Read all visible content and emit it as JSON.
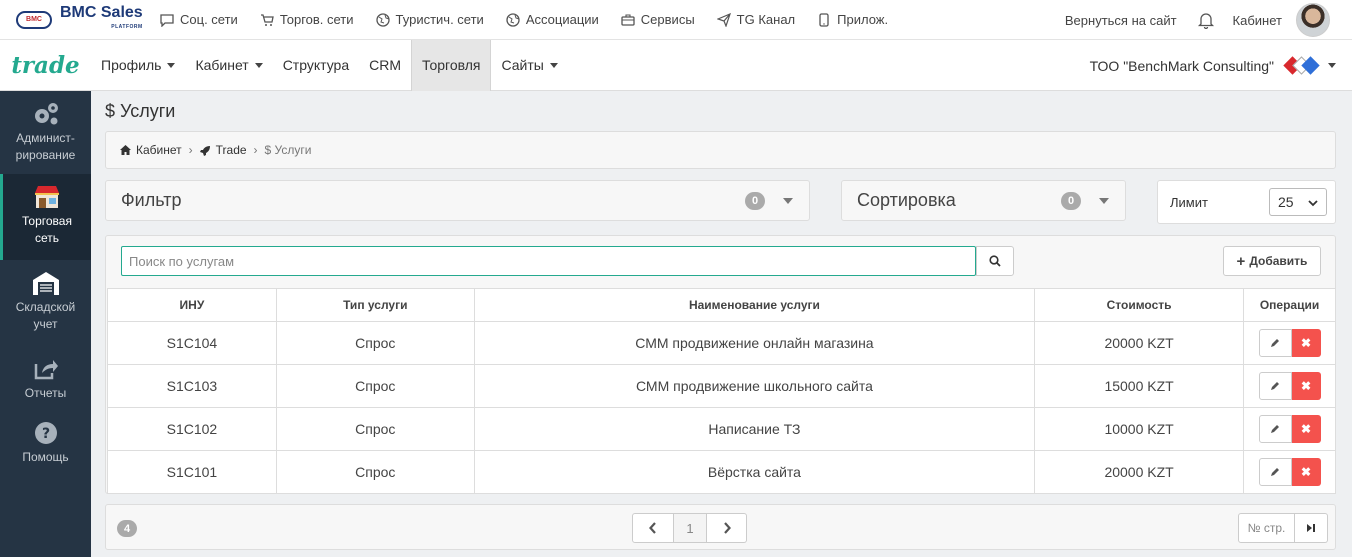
{
  "topbar": {
    "logo_mark": "BMC",
    "logo_text": "BMC Sales",
    "logo_sub": "PLATFORM",
    "nav": [
      {
        "label": "Соц. сети",
        "icon": "chat-icon"
      },
      {
        "label": "Торгов. сети",
        "icon": "cart-icon"
      },
      {
        "label": "Туристич. сети",
        "icon": "globe-icon"
      },
      {
        "label": "Ассоциации",
        "icon": "globe-icon"
      },
      {
        "label": "Сервисы",
        "icon": "briefcase-icon"
      },
      {
        "label": "TG Канал",
        "icon": "send-icon"
      },
      {
        "label": "Прилож.",
        "icon": "mobile-icon"
      }
    ],
    "back_link": "Вернуться на сайт",
    "cabinet_link": "Кабинет"
  },
  "navbar": {
    "brand": "trade",
    "items": [
      {
        "label": "Профиль",
        "dropdown": true
      },
      {
        "label": "Кабинет",
        "dropdown": true
      },
      {
        "label": "Структура",
        "dropdown": false
      },
      {
        "label": "CRM",
        "dropdown": false
      },
      {
        "label": "Торговля",
        "dropdown": false,
        "active": true
      },
      {
        "label": "Сайты",
        "dropdown": true
      }
    ],
    "company": "ТОО \"BenchMark Consulting\""
  },
  "sidebar": {
    "items": [
      {
        "label": "Админист-\nрирование",
        "icon": "gears-icon"
      },
      {
        "label": "Торговая\nсеть",
        "icon": "store-icon",
        "active": true
      },
      {
        "label": "Складской\nучет",
        "icon": "warehouse-icon"
      },
      {
        "label": "Отчеты",
        "icon": "share-icon"
      },
      {
        "label": "Помощь",
        "icon": "help-icon"
      }
    ]
  },
  "page": {
    "title": "$ Услуги",
    "breadcrumbs": [
      "Кабинет",
      "Trade",
      "$ Услуги"
    ]
  },
  "filter": {
    "label": "Фильтр",
    "count": "0"
  },
  "sort": {
    "label": "Сортировка",
    "count": "0"
  },
  "limit": {
    "label": "Лимит",
    "value": "25"
  },
  "search": {
    "placeholder": "Поиск по услугам",
    "value": ""
  },
  "add_button": "Добавить",
  "table": {
    "columns": [
      "ИНУ",
      "Тип услуги",
      "Наименование услуги",
      "Стоимость",
      "Операции"
    ],
    "rows": [
      {
        "id": "S1C104",
        "type": "Спрос",
        "name": "СММ продвижение онлайн магазина",
        "price": "20000 KZT"
      },
      {
        "id": "S1C103",
        "type": "Спрос",
        "name": "СММ продвижение школьного сайта",
        "price": "15000 KZT"
      },
      {
        "id": "S1C102",
        "type": "Спрос",
        "name": "Написание ТЗ",
        "price": "10000 KZT"
      },
      {
        "id": "S1C101",
        "type": "Спрос",
        "name": "Вёрстка сайта",
        "price": "20000 KZT"
      }
    ]
  },
  "footer": {
    "total": "4",
    "current_page": "1",
    "goto_placeholder": "№ стр."
  },
  "colors": {
    "accent": "#24a98f",
    "sidebar": "#253444",
    "danger": "#f4524d"
  }
}
